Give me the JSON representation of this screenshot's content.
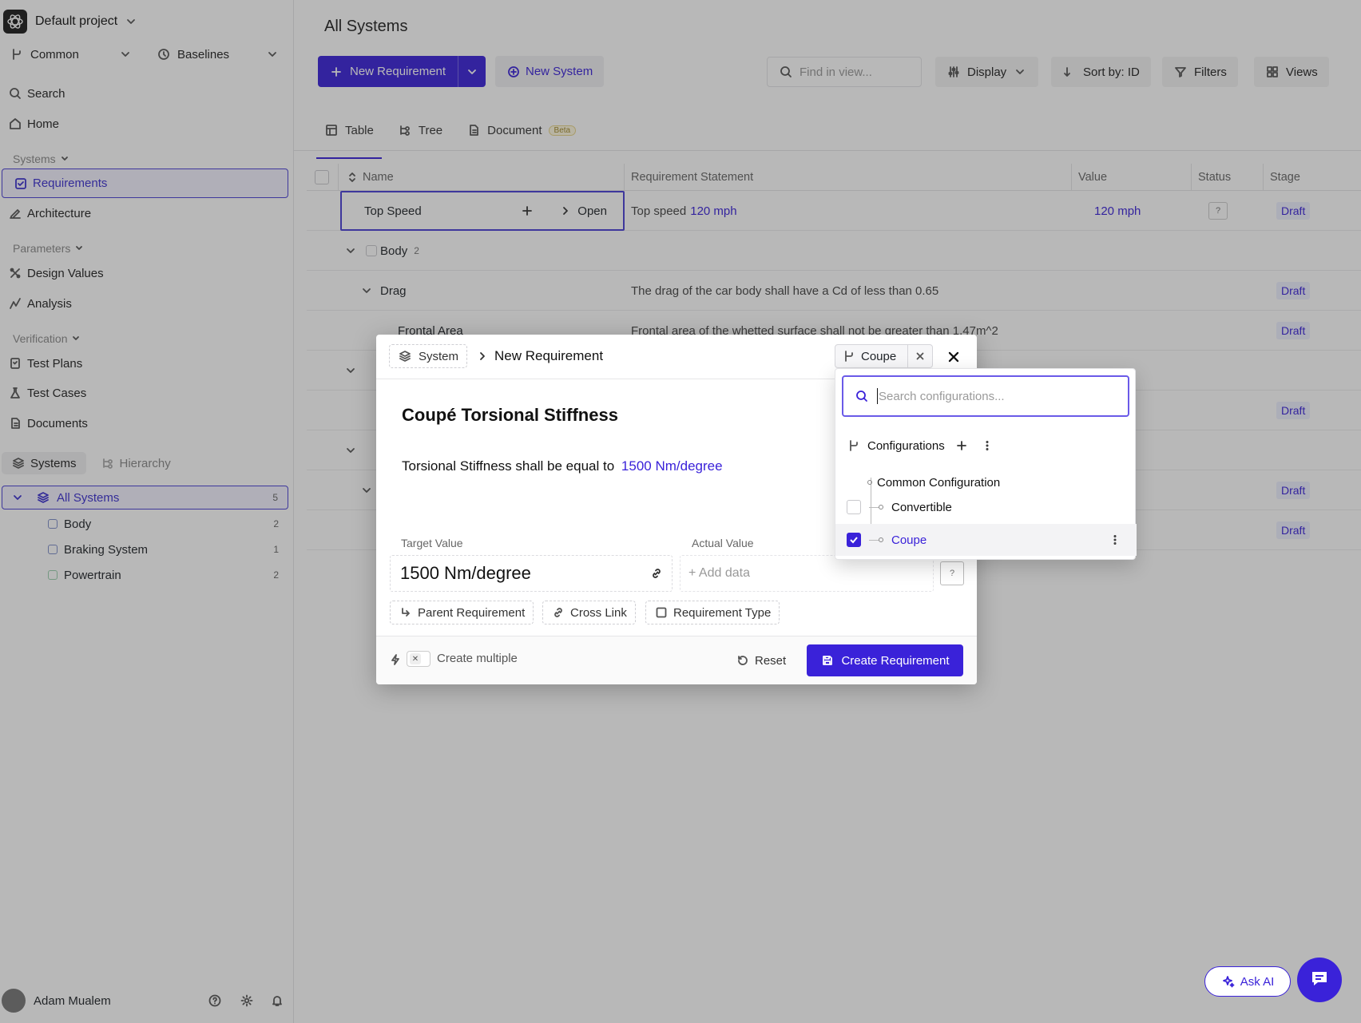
{
  "sidebar": {
    "project": "Default project",
    "selector_left": "Common",
    "selector_right": "Baselines",
    "nav_top": [
      {
        "label": "Search",
        "icon": "search-icon"
      },
      {
        "label": "Home",
        "icon": "home-icon"
      }
    ],
    "section_systems": "Systems",
    "nav_systems": [
      {
        "label": "Requirements",
        "icon": "requirements-icon"
      },
      {
        "label": "Architecture",
        "icon": "architecture-icon"
      }
    ],
    "section_parameters": "Parameters",
    "nav_parameters": [
      {
        "label": "Design Values",
        "icon": "design-values-icon"
      },
      {
        "label": "Analysis",
        "icon": "analysis-icon"
      }
    ],
    "section_verification": "Verification",
    "nav_verification": [
      {
        "label": "Test Plans",
        "icon": "test-plans-icon"
      },
      {
        "label": "Test Cases",
        "icon": "test-cases-icon"
      },
      {
        "label": "Documents",
        "icon": "documents-icon"
      }
    ],
    "tab_systems": "Systems",
    "tab_hierarchy": "Hierarchy",
    "tree": [
      {
        "label": "All Systems",
        "count": "5"
      },
      {
        "label": "Body",
        "count": "2"
      },
      {
        "label": "Braking System",
        "count": "1"
      },
      {
        "label": "Powertrain",
        "count": "2"
      }
    ],
    "user": "Adam Mualem"
  },
  "main": {
    "title": "All Systems",
    "new_requirement": "New Requirement",
    "new_system": "New System",
    "search_placeholder": "Find in view...",
    "display": "Display",
    "sort": "Sort by: ID",
    "filters": "Filters",
    "views": "Views",
    "tabs": [
      {
        "label": "Table"
      },
      {
        "label": "Tree"
      },
      {
        "label": "Document"
      }
    ],
    "beta": "Beta",
    "columns": {
      "name": "Name",
      "statement": "Requirement Statement",
      "value": "Value",
      "status": "Status",
      "stage": "Stage"
    },
    "rows": {
      "top_speed": {
        "name": "Top Speed",
        "open": "Open",
        "statement_prefix": "Top speed",
        "statement_value": "120 mph",
        "value": "120 mph",
        "status": "?",
        "stage": "Draft"
      },
      "body": {
        "name": "Body",
        "count": "2"
      },
      "drag": {
        "name": "Drag",
        "statement": "The drag of the car body shall have a Cd of less than 0.65",
        "stage": "Draft"
      },
      "frontal": {
        "name": "Frontal Area",
        "statement": "Frontal area of the whetted surface shall not be greater than 1.47m^2",
        "stage": "Draft"
      },
      "draft_labels": [
        "Draft",
        "Draft",
        "Draft"
      ]
    }
  },
  "modal": {
    "breadcrumb_system": "System",
    "breadcrumb_title": "New Requirement",
    "config_chip": "Coupe",
    "req_title": "Coupé Torsional Stiffness",
    "statement_prefix": "Torsional Stiffness shall be equal to",
    "statement_value": "1500 Nm/degree",
    "target_label": "Target Value",
    "target_value": "1500 Nm/degree",
    "actual_label": "Actual Value",
    "actual_placeholder": "+ Add data",
    "status_q": "?",
    "parent_req": "Parent Requirement",
    "cross_link": "Cross Link",
    "req_type": "Requirement Type",
    "create_multiple": "Create multiple",
    "reset": "Reset",
    "create": "Create Requirement"
  },
  "dropdown": {
    "search_placeholder": "Search configurations...",
    "header": "Configurations",
    "items": [
      {
        "label": "Common Configuration"
      },
      {
        "label": "Convertible",
        "checked": false
      },
      {
        "label": "Coupe",
        "checked": true
      }
    ]
  },
  "ask_ai": "Ask AI",
  "colors": {
    "accent": "#3a22d9",
    "overlay": "rgba(40,40,40,0.33)"
  }
}
